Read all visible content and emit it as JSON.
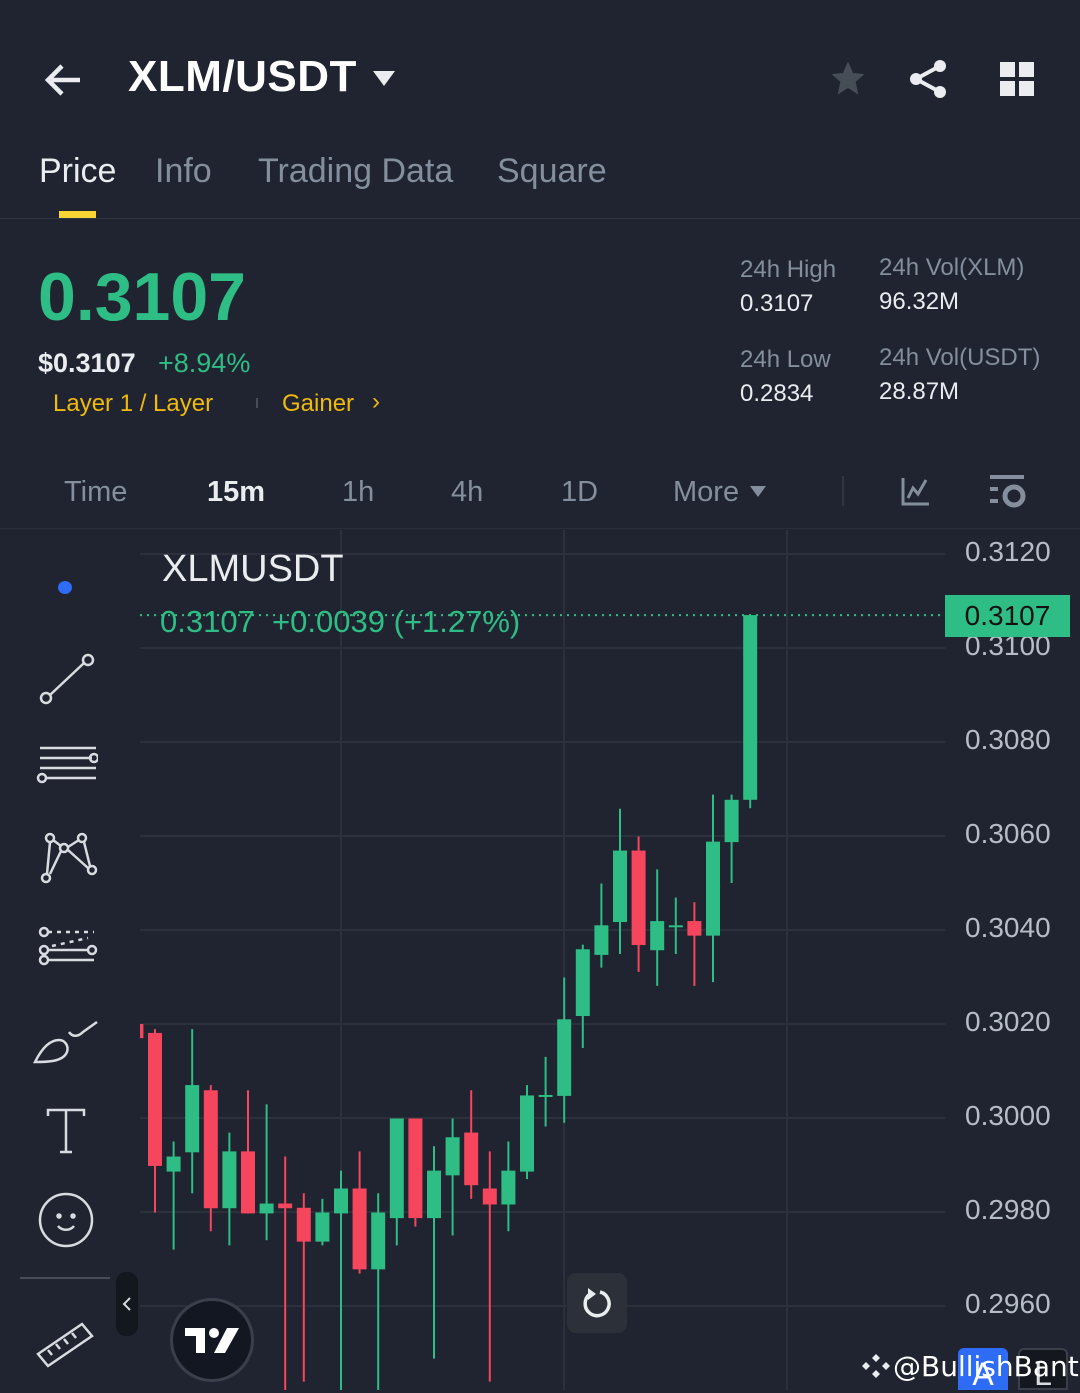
{
  "header": {
    "title": "XLM/USDT"
  },
  "tabs": [
    {
      "label": "Price"
    },
    {
      "label": "Info"
    },
    {
      "label": "Trading Data"
    },
    {
      "label": "Square"
    }
  ],
  "ticker": {
    "last_price": "0.3107",
    "fiat_price": "$0.3107",
    "change_pct": "+8.94%",
    "tag1": "Layer 1 / Layer",
    "tag2": "Gainer",
    "stats": {
      "high_label": "24h High",
      "high": "0.3107",
      "low_label": "24h Low",
      "low": "0.2834",
      "vol_base_label": "24h Vol(XLM)",
      "vol_base": "96.32M",
      "vol_quote_label": "24h Vol(USDT)",
      "vol_quote": "28.87M"
    }
  },
  "intervals": [
    {
      "label": "Time"
    },
    {
      "label": "15m"
    },
    {
      "label": "1h"
    },
    {
      "label": "4h"
    },
    {
      "label": "1D"
    },
    {
      "label": "More"
    }
  ],
  "chart": {
    "symbol": "XLMUSDT",
    "legend": "0.3107  +0.0039 (+1.27%)",
    "current_price": "0.3107",
    "watermark": "@BullishBanter",
    "badge_a": "A",
    "badge_l": "L"
  },
  "colors": {
    "up": "#2ebd85",
    "down": "#f6465d",
    "accent": "#fcd535"
  },
  "chart_data": {
    "type": "candlestick",
    "interval": "15m",
    "ylim": [
      0.295,
      0.3128
    ],
    "yticks": [
      "0.3120",
      "0.3100",
      "0.3080",
      "0.3060",
      "0.3040",
      "0.3020",
      "0.3000",
      "0.2980",
      "0.2960"
    ],
    "current": 0.3107,
    "candles": [
      {
        "o": 0.302,
        "h": 0.302,
        "l": 0.3017,
        "c": 0.3017
      },
      {
        "o": 0.30181,
        "h": 0.30189,
        "l": 0.29799,
        "c": 0.29898
      },
      {
        "o": 0.29886,
        "h": 0.2995,
        "l": 0.2972,
        "c": 0.29918
      },
      {
        "o": 0.29927,
        "h": 0.30189,
        "l": 0.2984,
        "c": 0.3007
      },
      {
        "o": 0.30059,
        "h": 0.3007,
        "l": 0.29759,
        "c": 0.29808
      },
      {
        "o": 0.29808,
        "h": 0.29969,
        "l": 0.29729,
        "c": 0.29929
      },
      {
        "o": 0.29929,
        "h": 0.30059,
        "l": 0.29797,
        "c": 0.29797
      },
      {
        "o": 0.29797,
        "h": 0.30029,
        "l": 0.2974,
        "c": 0.29818
      },
      {
        "o": 0.29818,
        "h": 0.29918,
        "l": 0.2942,
        "c": 0.29808
      },
      {
        "o": 0.29809,
        "h": 0.2984,
        "l": 0.29439,
        "c": 0.29737
      },
      {
        "o": 0.29737,
        "h": 0.29828,
        "l": 0.29729,
        "c": 0.29799
      },
      {
        "o": 0.29797,
        "h": 0.29888,
        "l": 0.2942,
        "c": 0.2985
      },
      {
        "o": 0.2985,
        "h": 0.29929,
        "l": 0.29669,
        "c": 0.29678
      },
      {
        "o": 0.29678,
        "h": 0.2984,
        "l": 0.29327,
        "c": 0.29799
      },
      {
        "o": 0.29787,
        "h": 0.29999,
        "l": 0.29729,
        "c": 0.29999
      },
      {
        "o": 0.29999,
        "h": 0.29999,
        "l": 0.29769,
        "c": 0.29787
      },
      {
        "o": 0.29787,
        "h": 0.2994,
        "l": 0.29488,
        "c": 0.29888
      },
      {
        "o": 0.29878,
        "h": 0.29999,
        "l": 0.2975,
        "c": 0.29959
      },
      {
        "o": 0.29969,
        "h": 0.30059,
        "l": 0.29828,
        "c": 0.29857
      },
      {
        "o": 0.2985,
        "h": 0.29929,
        "l": 0.29439,
        "c": 0.29816
      },
      {
        "o": 0.29816,
        "h": 0.2995,
        "l": 0.29759,
        "c": 0.29888
      },
      {
        "o": 0.29886,
        "h": 0.3007,
        "l": 0.2987,
        "c": 0.30048
      },
      {
        "o": 0.30049,
        "h": 0.3013,
        "l": 0.29982,
        "c": 0.30049
      },
      {
        "o": 0.30047,
        "h": 0.30299,
        "l": 0.2999,
        "c": 0.3021
      },
      {
        "o": 0.30217,
        "h": 0.30369,
        "l": 0.30149,
        "c": 0.30359
      },
      {
        "o": 0.30347,
        "h": 0.30499,
        "l": 0.3032,
        "c": 0.3041
      },
      {
        "o": 0.30417,
        "h": 0.30658,
        "l": 0.30349,
        "c": 0.30569
      },
      {
        "o": 0.30569,
        "h": 0.30599,
        "l": 0.30311,
        "c": 0.30368
      },
      {
        "o": 0.30357,
        "h": 0.30529,
        "l": 0.30281,
        "c": 0.30419
      },
      {
        "o": 0.3041,
        "h": 0.30469,
        "l": 0.30349,
        "c": 0.3041
      },
      {
        "o": 0.30419,
        "h": 0.30459,
        "l": 0.30281,
        "c": 0.30388
      },
      {
        "o": 0.30388,
        "h": 0.30688,
        "l": 0.30289,
        "c": 0.30588
      },
      {
        "o": 0.30587,
        "h": 0.30688,
        "l": 0.305,
        "c": 0.30677
      },
      {
        "o": 0.30677,
        "h": 0.3107,
        "l": 0.30659,
        "c": 0.3107
      }
    ]
  }
}
